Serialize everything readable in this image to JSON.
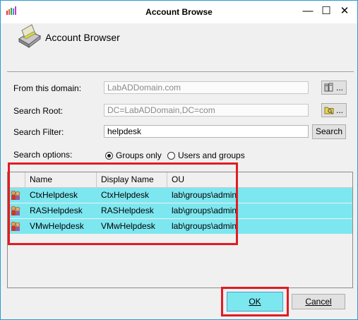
{
  "window": {
    "title": "Account Browse"
  },
  "titlebar_buttons": {
    "minimize": "—",
    "maximize": "☐",
    "close": "✕"
  },
  "header": {
    "title": "Account Browser"
  },
  "form": {
    "domain_label": "From this domain:",
    "domain_value": "LabADDomain.com",
    "root_label": "Search Root:",
    "root_value": "DC=LabADDomain,DC=com",
    "filter_label": "Search Filter:",
    "filter_value": "helpdesk",
    "search_button": "Search",
    "browse_label": "...",
    "options_label": "Search options:",
    "option_groups": "Groups only",
    "option_users": "Users and groups",
    "selected_option": "Groups only"
  },
  "grid": {
    "columns": [
      "Name",
      "Display Name",
      "OU"
    ],
    "rows": [
      {
        "name": "CtxHelpdesk",
        "display": "CtxHelpdesk",
        "ou": "lab\\groups\\admin"
      },
      {
        "name": "RASHelpdesk",
        "display": "RASHelpdesk",
        "ou": "lab\\groups\\admin"
      },
      {
        "name": "VMwHelpdesk",
        "display": "VMwHelpdesk",
        "ou": "lab\\groups\\admin"
      }
    ]
  },
  "footer": {
    "ok": "OK",
    "cancel": "Cancel"
  },
  "colors": {
    "selection": "#7de7f0",
    "highlight": "#e01c24",
    "accent": "#2b9ad6"
  }
}
